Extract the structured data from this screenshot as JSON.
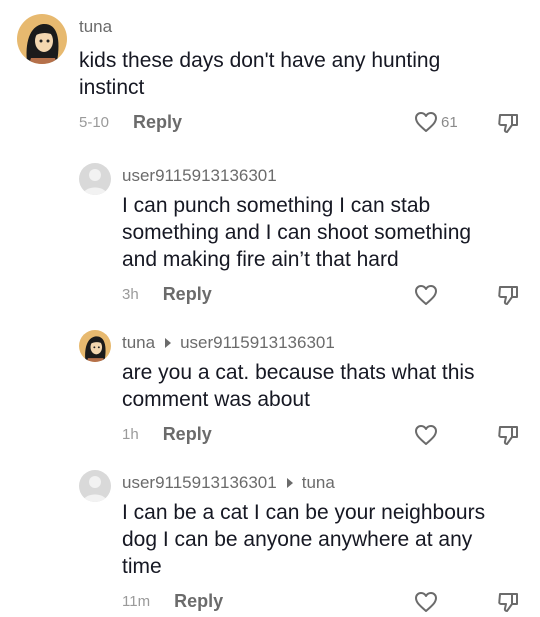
{
  "comments": [
    {
      "username": "tuna",
      "reply_to": "",
      "text": "kids these days don't have any hunting instinct",
      "time": "5-10",
      "reply_label": "Reply",
      "like_count": "61",
      "avatar": "cartoon-girl-avatar"
    },
    {
      "username": "user9115913136301",
      "reply_to": "",
      "text": "I can punch something I can stab something and I can shoot something and making fire ain’t that hard",
      "time": "3h",
      "reply_label": "Reply",
      "like_count": "",
      "avatar": "default-avatar"
    },
    {
      "username": "tuna",
      "reply_to": "user9115913136301",
      "text": "are you a cat. because thats what this comment was about",
      "time": "1h",
      "reply_label": "Reply",
      "like_count": "",
      "avatar": "cartoon-girl-avatar"
    },
    {
      "username": "user9115913136301",
      "reply_to": "tuna",
      "text": "I can be a cat I can be your neighbours dog I can be anyone anywhere at any time",
      "time": "11m",
      "reply_label": "Reply",
      "like_count": "",
      "avatar": "default-avatar"
    }
  ]
}
